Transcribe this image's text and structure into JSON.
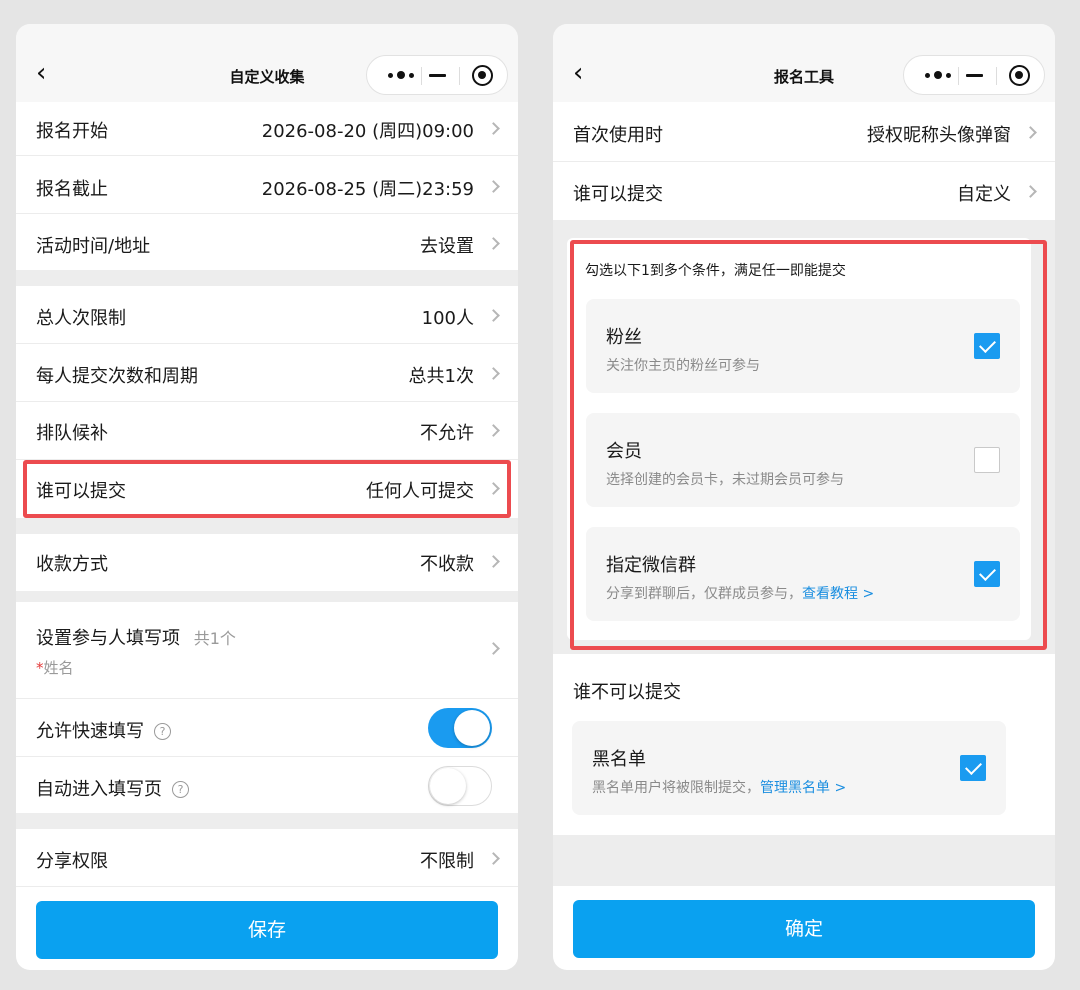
{
  "colors": {
    "accent": "#0aa1f0",
    "highlight_border": "#ec4b4f",
    "link": "#1a8ee0",
    "required_star": "#e33b3b"
  },
  "left": {
    "nav": {
      "back_icon": "‹",
      "title": "自定义收集"
    },
    "rows": {
      "signup_start": {
        "label": "报名开始",
        "value": "2026-08-20 (周四)09:00"
      },
      "signup_end": {
        "label": "报名截止",
        "value": "2026-08-25 (周二)23:59"
      },
      "activity_time_address": {
        "label": "活动时间/地址",
        "value": "去设置"
      },
      "total_limit": {
        "label": "总人次限制",
        "value": "100人"
      },
      "per_person_submit": {
        "label": "每人提交次数和周期",
        "value": "总共1次"
      },
      "waitlist": {
        "label": "排队候补",
        "value": "不允许"
      },
      "who_can_submit": {
        "label": "谁可以提交",
        "value": "任何人可提交"
      },
      "payment_method": {
        "label": "收款方式",
        "value": "不收款"
      },
      "share_permission": {
        "label": "分享权限",
        "value": "不限制"
      }
    },
    "fields": {
      "label": "设置参与人填写项",
      "count": "共1个",
      "required_star": "*",
      "field_name": "姓名"
    },
    "quick_fill": {
      "label": "允许快速填写",
      "help_icon": "?",
      "enabled": true
    },
    "auto_enter": {
      "label": "自动进入填写页",
      "help_icon": "?",
      "enabled": false
    },
    "save_label": "保存"
  },
  "right": {
    "nav": {
      "back_icon": "‹",
      "title": "报名工具"
    },
    "rows": {
      "first_use": {
        "label": "首次使用时",
        "value": "授权昵称头像弹窗"
      },
      "who_can_submit": {
        "label": "谁可以提交",
        "value": "自定义"
      }
    },
    "conditions": {
      "hint": "勾选以下1到多个条件，满足任一即能提交",
      "items": [
        {
          "title": "粉丝",
          "desc": "关注你主页的粉丝可参与",
          "link": "",
          "checked": true
        },
        {
          "title": "会员",
          "desc": "选择创建的会员卡，未过期会员可参与",
          "link": "",
          "checked": false
        },
        {
          "title": "指定微信群",
          "desc": "分享到群聊后，仅群成员参与，",
          "link": "查看教程 >",
          "checked": true
        }
      ]
    },
    "cannot_submit": {
      "heading": "谁不可以提交",
      "blacklist": {
        "title": "黑名单",
        "desc": "黑名单用户将被限制提交，",
        "link": "管理黑名单 >",
        "checked": true
      }
    },
    "confirm_label": "确定"
  }
}
